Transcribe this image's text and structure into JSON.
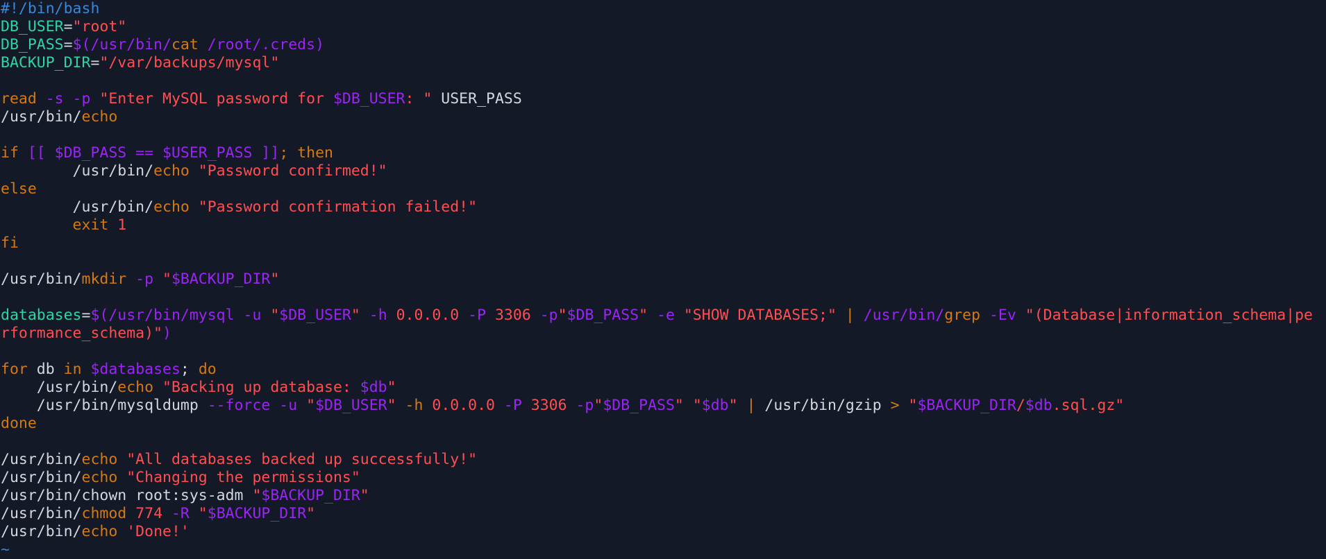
{
  "colors": {
    "background": "#131926",
    "default": "#d4d7de",
    "comment": "#3a86d8",
    "variable": "#2fd3a7",
    "string": "#ff4f52",
    "keyword": "#d37a16",
    "special": "#9a25f4",
    "tilde": "#3b82c4"
  },
  "lines": [
    [
      {
        "t": "#!/bin/bash",
        "c": "comment"
      }
    ],
    [
      {
        "t": "DB_USER",
        "c": "variable"
      },
      {
        "t": "=",
        "c": "default"
      },
      {
        "t": "\"root\"",
        "c": "string"
      }
    ],
    [
      {
        "t": "DB_PASS",
        "c": "variable"
      },
      {
        "t": "=",
        "c": "default"
      },
      {
        "t": "$(/usr/bin/",
        "c": "special"
      },
      {
        "t": "cat",
        "c": "keyword"
      },
      {
        "t": " /root/.creds)",
        "c": "special"
      }
    ],
    [
      {
        "t": "BACKUP_DIR",
        "c": "variable"
      },
      {
        "t": "=",
        "c": "default"
      },
      {
        "t": "\"/var/backups/mysql\"",
        "c": "string"
      }
    ],
    [],
    [
      {
        "t": "read",
        "c": "keyword"
      },
      {
        "t": " -s -p ",
        "c": "special"
      },
      {
        "t": "\"Enter MySQL password for ",
        "c": "string"
      },
      {
        "t": "$DB_USER",
        "c": "special"
      },
      {
        "t": ": \"",
        "c": "string"
      },
      {
        "t": " USER_PASS",
        "c": "default"
      }
    ],
    [
      {
        "t": "/usr/bin/",
        "c": "default"
      },
      {
        "t": "echo",
        "c": "keyword"
      }
    ],
    [],
    [
      {
        "t": "if",
        "c": "keyword"
      },
      {
        "t": " [[ ",
        "c": "special"
      },
      {
        "t": "$DB_PASS",
        "c": "special"
      },
      {
        "t": " == ",
        "c": "special"
      },
      {
        "t": "$USER_PASS",
        "c": "special"
      },
      {
        "t": " ]]",
        "c": "special"
      },
      {
        "t": "; ",
        "c": "keyword"
      },
      {
        "t": "then",
        "c": "keyword"
      }
    ],
    [
      {
        "t": "        /usr/bin/",
        "c": "default"
      },
      {
        "t": "echo",
        "c": "keyword"
      },
      {
        "t": " ",
        "c": "default"
      },
      {
        "t": "\"Password confirmed!\"",
        "c": "string"
      }
    ],
    [
      {
        "t": "else",
        "c": "keyword"
      }
    ],
    [
      {
        "t": "        /usr/bin/",
        "c": "default"
      },
      {
        "t": "echo",
        "c": "keyword"
      },
      {
        "t": " ",
        "c": "default"
      },
      {
        "t": "\"Password confirmation failed!\"",
        "c": "string"
      }
    ],
    [
      {
        "t": "        exit",
        "c": "keyword"
      },
      {
        "t": " 1",
        "c": "string"
      }
    ],
    [
      {
        "t": "fi",
        "c": "keyword"
      }
    ],
    [],
    [
      {
        "t": "/usr/bin/",
        "c": "default"
      },
      {
        "t": "mkdir",
        "c": "keyword"
      },
      {
        "t": " -p ",
        "c": "special"
      },
      {
        "t": "\"",
        "c": "string"
      },
      {
        "t": "$BACKUP_DIR",
        "c": "special"
      },
      {
        "t": "\"",
        "c": "string"
      }
    ],
    [],
    [
      {
        "t": "databases",
        "c": "variable"
      },
      {
        "t": "=",
        "c": "default"
      },
      {
        "t": "$(/usr/bin/mysql -u ",
        "c": "special"
      },
      {
        "t": "\"",
        "c": "string"
      },
      {
        "t": "$DB_USER",
        "c": "special"
      },
      {
        "t": "\"",
        "c": "string"
      },
      {
        "t": " -h ",
        "c": "special"
      },
      {
        "t": "0.0.0.0",
        "c": "string"
      },
      {
        "t": " -P ",
        "c": "special"
      },
      {
        "t": "3306",
        "c": "string"
      },
      {
        "t": " -p",
        "c": "special"
      },
      {
        "t": "\"",
        "c": "string"
      },
      {
        "t": "$DB_PASS",
        "c": "special"
      },
      {
        "t": "\"",
        "c": "string"
      },
      {
        "t": " -e ",
        "c": "special"
      },
      {
        "t": "\"SHOW DATABASES;\"",
        "c": "string"
      },
      {
        "t": " | ",
        "c": "keyword"
      },
      {
        "t": "/usr/bin/",
        "c": "special"
      },
      {
        "t": "grep",
        "c": "keyword"
      },
      {
        "t": " -Ev ",
        "c": "special"
      },
      {
        "t": "\"(Database|information_schema|pe",
        "c": "string"
      }
    ],
    [
      {
        "t": "rformance_schema)\"",
        "c": "string"
      },
      {
        "t": ")",
        "c": "special"
      }
    ],
    [],
    [
      {
        "t": "for",
        "c": "keyword"
      },
      {
        "t": " db ",
        "c": "default"
      },
      {
        "t": "in",
        "c": "keyword"
      },
      {
        "t": " ",
        "c": "default"
      },
      {
        "t": "$databases",
        "c": "special"
      },
      {
        "t": "; ",
        "c": "default"
      },
      {
        "t": "do",
        "c": "keyword"
      }
    ],
    [
      {
        "t": "    /usr/bin/",
        "c": "default"
      },
      {
        "t": "echo",
        "c": "keyword"
      },
      {
        "t": " ",
        "c": "default"
      },
      {
        "t": "\"Backing up database: ",
        "c": "string"
      },
      {
        "t": "$db",
        "c": "special"
      },
      {
        "t": "\"",
        "c": "string"
      }
    ],
    [
      {
        "t": "    /usr/bin/mysqldump",
        "c": "default"
      },
      {
        "t": " --force -u ",
        "c": "special"
      },
      {
        "t": "\"",
        "c": "string"
      },
      {
        "t": "$DB_USER",
        "c": "special"
      },
      {
        "t": "\"",
        "c": "string"
      },
      {
        "t": " -h ",
        "c": "keyword"
      },
      {
        "t": "0.0.0.0",
        "c": "string"
      },
      {
        "t": " -P ",
        "c": "special"
      },
      {
        "t": "3306",
        "c": "string"
      },
      {
        "t": " -p",
        "c": "special"
      },
      {
        "t": "\"",
        "c": "string"
      },
      {
        "t": "$DB_PASS",
        "c": "special"
      },
      {
        "t": "\"",
        "c": "string"
      },
      {
        "t": " ",
        "c": "default"
      },
      {
        "t": "\"",
        "c": "string"
      },
      {
        "t": "$db",
        "c": "special"
      },
      {
        "t": "\"",
        "c": "string"
      },
      {
        "t": " | ",
        "c": "keyword"
      },
      {
        "t": "/usr/bin/gzip",
        "c": "default"
      },
      {
        "t": " > ",
        "c": "keyword"
      },
      {
        "t": "\"",
        "c": "string"
      },
      {
        "t": "$BACKUP_DIR",
        "c": "special"
      },
      {
        "t": "/",
        "c": "string"
      },
      {
        "t": "$db",
        "c": "special"
      },
      {
        "t": ".sql.gz\"",
        "c": "string"
      }
    ],
    [
      {
        "t": "done",
        "c": "keyword"
      }
    ],
    [],
    [
      {
        "t": "/usr/bin/",
        "c": "default"
      },
      {
        "t": "echo",
        "c": "keyword"
      },
      {
        "t": " ",
        "c": "default"
      },
      {
        "t": "\"All databases backed up successfully!\"",
        "c": "string"
      }
    ],
    [
      {
        "t": "/usr/bin/",
        "c": "default"
      },
      {
        "t": "echo",
        "c": "keyword"
      },
      {
        "t": " ",
        "c": "default"
      },
      {
        "t": "\"Changing the permissions\"",
        "c": "string"
      }
    ],
    [
      {
        "t": "/usr/bin/chown root:sys-adm ",
        "c": "default"
      },
      {
        "t": "\"",
        "c": "string"
      },
      {
        "t": "$BACKUP_DIR",
        "c": "special"
      },
      {
        "t": "\"",
        "c": "string"
      }
    ],
    [
      {
        "t": "/usr/bin/",
        "c": "default"
      },
      {
        "t": "chmod",
        "c": "keyword"
      },
      {
        "t": " 774",
        "c": "string"
      },
      {
        "t": " -R ",
        "c": "special"
      },
      {
        "t": "\"",
        "c": "string"
      },
      {
        "t": "$BACKUP_DIR",
        "c": "special"
      },
      {
        "t": "\"",
        "c": "string"
      }
    ],
    [
      {
        "t": "/usr/bin/",
        "c": "default"
      },
      {
        "t": "echo",
        "c": "keyword"
      },
      {
        "t": " ",
        "c": "default"
      },
      {
        "t": "'Done!'",
        "c": "string"
      }
    ],
    [
      {
        "t": "~",
        "c": "tilde"
      }
    ]
  ]
}
